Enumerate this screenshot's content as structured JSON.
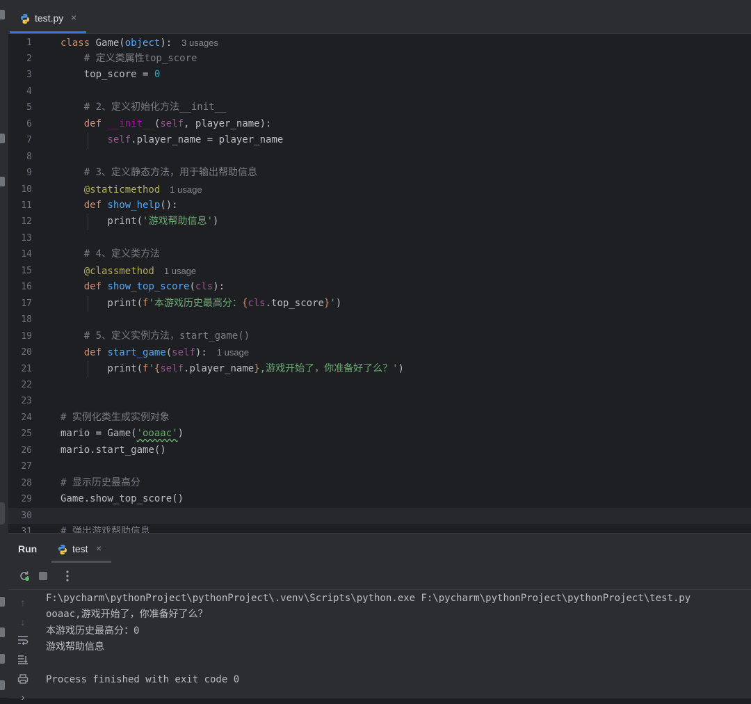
{
  "tab": {
    "title": "test.py",
    "close": "×",
    "icon": "python-file-icon"
  },
  "editor": {
    "current_line": 30,
    "lines": [
      {
        "n": "1",
        "tokens": [
          {
            "c": "kw",
            "t": "class "
          },
          {
            "c": "",
            "t": "Game("
          },
          {
            "c": "fn-b",
            "t": "object"
          },
          {
            "c": "",
            "t": "):"
          }
        ],
        "usage": "3 usages"
      },
      {
        "n": "2",
        "tokens": [
          {
            "c": "",
            "t": "    "
          },
          {
            "c": "cmt",
            "t": "# 定义类属性top_score"
          }
        ]
      },
      {
        "n": "3",
        "tokens": [
          {
            "c": "",
            "t": "    top_score = "
          },
          {
            "c": "num",
            "t": "0"
          }
        ]
      },
      {
        "n": "4",
        "tokens": []
      },
      {
        "n": "5",
        "tokens": [
          {
            "c": "",
            "t": "    "
          },
          {
            "c": "cmt",
            "t": "# 2、定义初始化方法__init__"
          }
        ]
      },
      {
        "n": "6",
        "tokens": [
          {
            "c": "",
            "t": "    "
          },
          {
            "c": "kw",
            "t": "def "
          },
          {
            "c": "magic",
            "t": "__init__"
          },
          {
            "c": "",
            "t": "("
          },
          {
            "c": "self",
            "t": "self"
          },
          {
            "c": "",
            "t": ", player_name):"
          }
        ]
      },
      {
        "n": "7",
        "tokens": [
          {
            "c": "",
            "t": "        "
          },
          {
            "c": "self",
            "t": "self"
          },
          {
            "c": "",
            "t": ".player_name = player_name"
          }
        ]
      },
      {
        "n": "8",
        "tokens": []
      },
      {
        "n": "9",
        "tokens": [
          {
            "c": "",
            "t": "    "
          },
          {
            "c": "cmt",
            "t": "# 3、定义静态方法，用于输出帮助信息"
          }
        ]
      },
      {
        "n": "10",
        "tokens": [
          {
            "c": "",
            "t": "    "
          },
          {
            "c": "deco",
            "t": "@staticmethod"
          }
        ],
        "usage": "1 usage"
      },
      {
        "n": "11",
        "tokens": [
          {
            "c": "",
            "t": "    "
          },
          {
            "c": "kw",
            "t": "def "
          },
          {
            "c": "fn",
            "t": "show_help"
          },
          {
            "c": "",
            "t": "():"
          }
        ]
      },
      {
        "n": "12",
        "tokens": [
          {
            "c": "",
            "t": "        print("
          },
          {
            "c": "str",
            "t": "'游戏帮助信息'"
          },
          {
            "c": "",
            "t": ")"
          }
        ]
      },
      {
        "n": "13",
        "tokens": []
      },
      {
        "n": "14",
        "tokens": [
          {
            "c": "",
            "t": "    "
          },
          {
            "c": "cmt",
            "t": "# 4、定义类方法"
          }
        ]
      },
      {
        "n": "15",
        "tokens": [
          {
            "c": "",
            "t": "    "
          },
          {
            "c": "deco",
            "t": "@classmethod"
          }
        ],
        "usage": "1 usage"
      },
      {
        "n": "16",
        "tokens": [
          {
            "c": "",
            "t": "    "
          },
          {
            "c": "kw",
            "t": "def "
          },
          {
            "c": "fn",
            "t": "show_top_score"
          },
          {
            "c": "",
            "t": "("
          },
          {
            "c": "self",
            "t": "cls"
          },
          {
            "c": "",
            "t": "):"
          }
        ]
      },
      {
        "n": "17",
        "tokens": [
          {
            "c": "",
            "t": "        print("
          },
          {
            "c": "kw",
            "t": "f"
          },
          {
            "c": "str",
            "t": "'本游戏历史最高分："
          },
          {
            "c": "kw",
            "t": "{"
          },
          {
            "c": "self",
            "t": "cls"
          },
          {
            "c": "",
            "t": ".top_score"
          },
          {
            "c": "kw",
            "t": "}"
          },
          {
            "c": "str",
            "t": "'"
          },
          {
            "c": "",
            "t": ")"
          }
        ]
      },
      {
        "n": "18",
        "tokens": []
      },
      {
        "n": "19",
        "tokens": [
          {
            "c": "",
            "t": "    "
          },
          {
            "c": "cmt",
            "t": "# 5、定义实例方法，start_game()"
          }
        ]
      },
      {
        "n": "20",
        "tokens": [
          {
            "c": "",
            "t": "    "
          },
          {
            "c": "kw",
            "t": "def "
          },
          {
            "c": "fn",
            "t": "start_game"
          },
          {
            "c": "",
            "t": "("
          },
          {
            "c": "self",
            "t": "self"
          },
          {
            "c": "",
            "t": "):"
          }
        ],
        "usage": "1 usage"
      },
      {
        "n": "21",
        "tokens": [
          {
            "c": "",
            "t": "        print("
          },
          {
            "c": "kw",
            "t": "f"
          },
          {
            "c": "str",
            "t": "'"
          },
          {
            "c": "kw",
            "t": "{"
          },
          {
            "c": "self",
            "t": "self"
          },
          {
            "c": "",
            "t": ".player_name"
          },
          {
            "c": "kw",
            "t": "}"
          },
          {
            "c": "str",
            "t": ",游戏开始了，你准备好了么？'"
          },
          {
            "c": "",
            "t": ")"
          }
        ]
      },
      {
        "n": "22",
        "tokens": []
      },
      {
        "n": "23",
        "tokens": []
      },
      {
        "n": "24",
        "tokens": [
          {
            "c": "cmt",
            "t": "# 实例化类生成实例对象"
          }
        ]
      },
      {
        "n": "25",
        "tokens": [
          {
            "c": "",
            "t": "mario = Game("
          },
          {
            "c": "str squig",
            "t": "'ooaac'"
          },
          {
            "c": "",
            "t": ")"
          }
        ]
      },
      {
        "n": "26",
        "tokens": [
          {
            "c": "",
            "t": "mario.start_game()"
          }
        ]
      },
      {
        "n": "27",
        "tokens": []
      },
      {
        "n": "28",
        "tokens": [
          {
            "c": "cmt",
            "t": "# 显示历史最高分"
          }
        ]
      },
      {
        "n": "29",
        "tokens": [
          {
            "c": "",
            "t": "Game.show_top_score()"
          }
        ]
      },
      {
        "n": "30",
        "tokens": []
      },
      {
        "n": "31",
        "tokens": [
          {
            "c": "cmt",
            "t": "# 弹出游戏帮助信息"
          }
        ]
      }
    ]
  },
  "run_panel": {
    "label": "Run",
    "tab_title": "test",
    "tab_close": "×",
    "console": [
      "F:\\pycharm\\pythonProject\\pythonProject\\.venv\\Scripts\\python.exe F:\\pycharm\\pythonProject\\pythonProject\\test.py",
      "ooaac,游戏开始了，你准备好了么？",
      "本游戏历史最高分：0",
      "游戏帮助信息",
      "",
      "Process finished with exit code 0"
    ]
  }
}
